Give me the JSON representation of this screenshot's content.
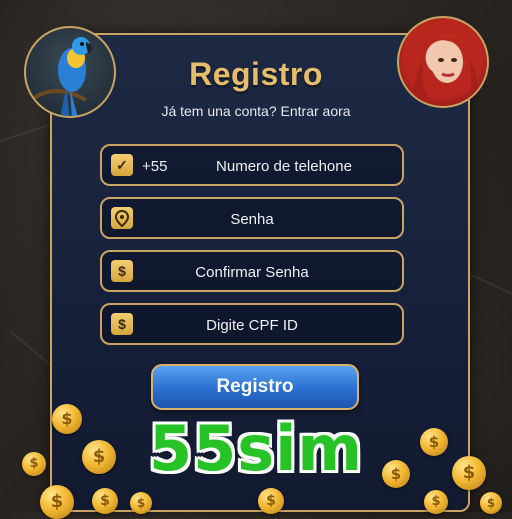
{
  "form": {
    "title": "Registro",
    "subtitle": "Já tem una conta? Entrar aora",
    "fields": [
      {
        "icon": "check-icon",
        "prefix": "+55",
        "placeholder": "Numero de telehone"
      },
      {
        "icon": "location-pin-icon",
        "placeholder": "Senha"
      },
      {
        "icon": "dollar-icon",
        "placeholder": "Confirmar Senha"
      },
      {
        "icon": "dollar-icon",
        "placeholder": "Digite CPF ID"
      }
    ],
    "submit_label": "Registro"
  },
  "brand": {
    "text": "55sim",
    "color": "#26c226"
  },
  "theme": {
    "accent_gold": "#c9a463",
    "title_gold": "#e6bd6a",
    "button_blue": "#2a6fd1",
    "panel_navy": "#1a2540"
  }
}
